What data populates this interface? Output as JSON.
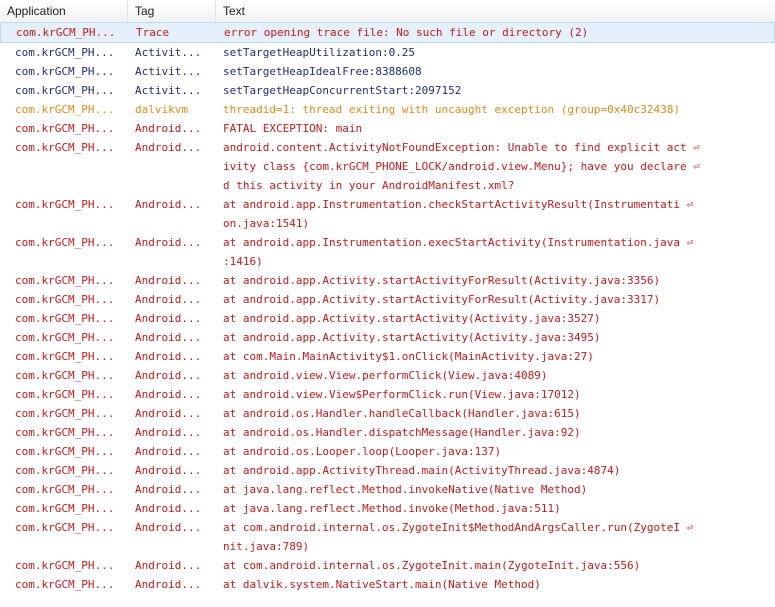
{
  "columns": {
    "application": "Application",
    "tag": "Tag",
    "text": "Text"
  },
  "rows": [
    {
      "level": "E",
      "selected": true,
      "app": "com.krGCM_PH...",
      "tag": "Trace",
      "lines": [
        "error opening trace file: No such file or directory (2)"
      ]
    },
    {
      "level": "D",
      "app": "com.krGCM_PH...",
      "tag": "Activit...",
      "lines": [
        "setTargetHeapUtilization:0.25"
      ]
    },
    {
      "level": "D",
      "app": "com.krGCM_PH...",
      "tag": "Activit...",
      "lines": [
        "setTargetHeapIdealFree:8388608"
      ]
    },
    {
      "level": "D",
      "app": "com.krGCM_PH...",
      "tag": "Activit...",
      "lines": [
        "setTargetHeapConcurrentStart:2097152"
      ]
    },
    {
      "level": "W",
      "app": "com.krGCM_PH...",
      "tag": "dalvikvm",
      "lines": [
        "threadid=1: thread exiting with uncaught exception (group=0x40c32438)"
      ]
    },
    {
      "level": "E",
      "app": "com.krGCM_PH...",
      "tag": "Android...",
      "lines": [
        "FATAL EXCEPTION: main"
      ]
    },
    {
      "level": "E",
      "app": "com.krGCM_PH...",
      "tag": "Android...",
      "lines": [
        "android.content.ActivityNotFoundException: Unable to find explicit act ⏎",
        "ivity class {com.krGCM_PHONE_LOCK/android.view.Menu}; have you declare ⏎",
        "d this activity in your AndroidManifest.xml?"
      ]
    },
    {
      "level": "E",
      "app": "com.krGCM_PH...",
      "tag": "Android...",
      "lines": [
        "at android.app.Instrumentation.checkStartActivityResult(Instrumentati ⏎",
        "on.java:1541)"
      ]
    },
    {
      "level": "E",
      "app": "com.krGCM_PH...",
      "tag": "Android...",
      "lines": [
        "at android.app.Instrumentation.execStartActivity(Instrumentation.java ⏎",
        ":1416)"
      ]
    },
    {
      "level": "E",
      "app": "com.krGCM_PH...",
      "tag": "Android...",
      "lines": [
        "at android.app.Activity.startActivityForResult(Activity.java:3356)"
      ]
    },
    {
      "level": "E",
      "app": "com.krGCM_PH...",
      "tag": "Android...",
      "lines": [
        "at android.app.Activity.startActivityForResult(Activity.java:3317)"
      ]
    },
    {
      "level": "E",
      "app": "com.krGCM_PH...",
      "tag": "Android...",
      "lines": [
        "at android.app.Activity.startActivity(Activity.java:3527)"
      ]
    },
    {
      "level": "E",
      "app": "com.krGCM_PH...",
      "tag": "Android...",
      "lines": [
        "at android.app.Activity.startActivity(Activity.java:3495)"
      ]
    },
    {
      "level": "E",
      "app": "com.krGCM_PH...",
      "tag": "Android...",
      "lines": [
        "at com.Main.MainActivity$1.onClick(MainActivity.java:27)"
      ]
    },
    {
      "level": "E",
      "app": "com.krGCM_PH...",
      "tag": "Android...",
      "lines": [
        "at android.view.View.performClick(View.java:4089)"
      ]
    },
    {
      "level": "E",
      "app": "com.krGCM_PH...",
      "tag": "Android...",
      "lines": [
        "at android.view.View$PerformClick.run(View.java:17012)"
      ]
    },
    {
      "level": "E",
      "app": "com.krGCM_PH...",
      "tag": "Android...",
      "lines": [
        "at android.os.Handler.handleCallback(Handler.java:615)"
      ]
    },
    {
      "level": "E",
      "app": "com.krGCM_PH...",
      "tag": "Android...",
      "lines": [
        "at android.os.Handler.dispatchMessage(Handler.java:92)"
      ]
    },
    {
      "level": "E",
      "app": "com.krGCM_PH...",
      "tag": "Android...",
      "lines": [
        "at android.os.Looper.loop(Looper.java:137)"
      ]
    },
    {
      "level": "E",
      "app": "com.krGCM_PH...",
      "tag": "Android...",
      "lines": [
        "at android.app.ActivityThread.main(ActivityThread.java:4874)"
      ]
    },
    {
      "level": "E",
      "app": "com.krGCM_PH...",
      "tag": "Android...",
      "lines": [
        "at java.lang.reflect.Method.invokeNative(Native Method)"
      ]
    },
    {
      "level": "E",
      "app": "com.krGCM_PH...",
      "tag": "Android...",
      "lines": [
        "at java.lang.reflect.Method.invoke(Method.java:511)"
      ]
    },
    {
      "level": "E",
      "app": "com.krGCM_PH...",
      "tag": "Android...",
      "lines": [
        "at com.android.internal.os.ZygoteInit$MethodAndArgsCaller.run(ZygoteI ⏎",
        "nit.java:789)"
      ]
    },
    {
      "level": "E",
      "app": "com.krGCM_PH...",
      "tag": "Android...",
      "lines": [
        "at com.android.internal.os.ZygoteInit.main(ZygoteInit.java:556)"
      ]
    },
    {
      "level": "E",
      "app": "com.krGCM_PH...",
      "tag": "Android...",
      "lines": [
        "at dalvik.system.NativeStart.main(Native Method)"
      ]
    }
  ],
  "colors": {
    "error": "#c41b1b",
    "debug": "#1f2f7a",
    "warning": "#e08a19",
    "selection": "#e5f0fb"
  }
}
